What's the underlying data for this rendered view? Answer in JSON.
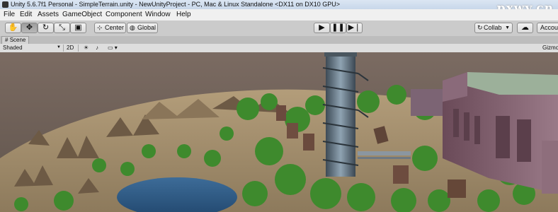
{
  "window": {
    "title": "Unity 5.6.7f1 Personal - SimpleTerrain.unity - NewUnityProject - PC, Mac & Linux Standalone <DX11 on DX10 GPU>",
    "watermark": "pxwy.cn"
  },
  "menu": [
    "File",
    "Edit",
    "Assets",
    "GameObject",
    "Component",
    "Window",
    "Help"
  ],
  "toolbar": {
    "tools": [
      "hand-tool",
      "move-tool",
      "rotate-tool",
      "scale-tool",
      "rect-tool"
    ],
    "pivot_label": "Center",
    "space_label": "Global",
    "play": [
      "play",
      "pause",
      "step"
    ],
    "collab_label": "Collab",
    "account_label": "Accou"
  },
  "scene_tab": {
    "label": "Scene"
  },
  "scene_bar": {
    "shading_mode": "Shaded",
    "mode_2d": "2D",
    "gizmos_label": "Gizmo"
  },
  "colors": {
    "titlebar": "#d3e0f0",
    "toolbar": "#cbcbcb",
    "sky": "#6f6055",
    "terrain": "#a48f6e",
    "water": "#335f8f",
    "foliage": "#3f8a2c",
    "building": "#7a5a68"
  }
}
